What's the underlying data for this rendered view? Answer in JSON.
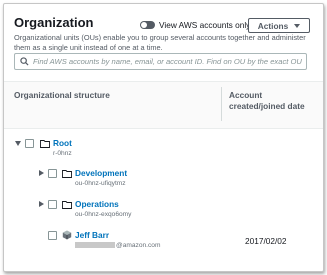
{
  "header": {
    "title": "Organization",
    "description": "Organizational units (OUs) enable you to group several accounts together and administer them as a single unit instead of one at a time.",
    "toggle_label": "View AWS accounts only",
    "actions_label": "Actions"
  },
  "search": {
    "placeholder": "Find AWS accounts by name, email, or account ID. Find on OU by the exact OU"
  },
  "table": {
    "col_structure": "Organizational structure",
    "col_created": "Account created/joined date"
  },
  "tree": {
    "root": {
      "name": "Root",
      "id": "r-0hnz"
    },
    "ous": [
      {
        "name": "Development",
        "id": "ou-0hnz-ufiqytmz"
      },
      {
        "name": "Operations",
        "id": "ou-0hnz-exqo6omy"
      }
    ],
    "account": {
      "name": "Jeff Barr",
      "email_suffix": "@amazon.com",
      "date": "2017/02/02"
    }
  },
  "colors": {
    "link": "#0073bb",
    "text": "#16191f",
    "muted": "#545b64",
    "border": "#aab7b8"
  },
  "icons": [
    "search-icon",
    "caret-down-icon",
    "folder-icon",
    "account-cube-icon",
    "expand-caret-icon"
  ]
}
